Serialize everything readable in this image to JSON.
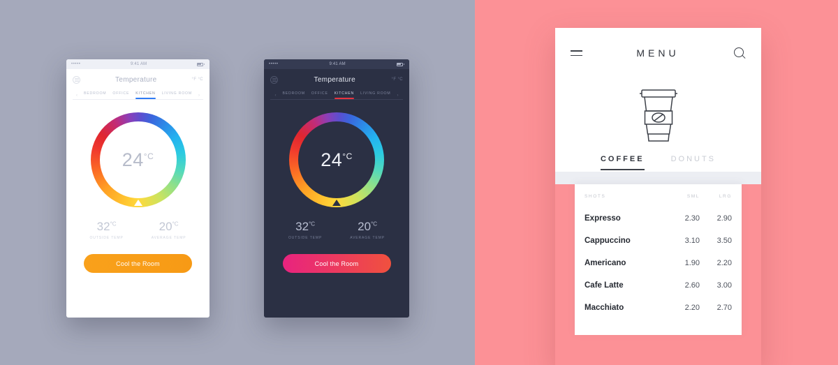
{
  "backgrounds": {
    "left": "#a5a9bb",
    "right": "#fc9196"
  },
  "thermostat": {
    "status_bar": {
      "signal": "•••••",
      "time": "9:41 AM"
    },
    "header": {
      "title": "Temperature",
      "menu_icon": "menu-circle-icon",
      "unit_toggle": "°F °C"
    },
    "room_tabs": {
      "prev_arrow": "‹",
      "next_arrow": "›",
      "items": [
        "BEDROOM",
        "OFFICE",
        "KITCHEN",
        "LIVING ROOM"
      ],
      "active_index": 2
    },
    "dial": {
      "value": "24",
      "unit": "°C",
      "marker_icon": "dial-marker-triangle"
    },
    "readings": [
      {
        "value": "32",
        "unit": "°C",
        "label": "OUTSIDE TEMP"
      },
      {
        "value": "20",
        "unit": "°C",
        "label": "AVERAGE TEMP"
      }
    ],
    "cta_label": "Cool the Room",
    "cta_color_light": "#f9a11b",
    "cta_color_dark": "#e8237f"
  },
  "menu": {
    "hamburger_icon": "hamburger-icon",
    "title": "MENU",
    "search_icon": "search-icon",
    "cup_icon": "coffee-cup-icon",
    "tabs": [
      {
        "label": "COFFEE",
        "active": true
      },
      {
        "label": "DONUTS",
        "active": false
      }
    ],
    "table": {
      "headers": {
        "name": "SHOTS",
        "sml": "SML",
        "lrg": "LRG"
      },
      "rows": [
        {
          "name": "Expresso",
          "sml": "2.30",
          "lrg": "2.90"
        },
        {
          "name": "Cappuccino",
          "sml": "3.10",
          "lrg": "3.50"
        },
        {
          "name": "Americano",
          "sml": "1.90",
          "lrg": "2.20"
        },
        {
          "name": "Cafe Latte",
          "sml": "2.60",
          "lrg": "3.00"
        },
        {
          "name": "Macchiato",
          "sml": "2.20",
          "lrg": "2.70"
        }
      ]
    }
  }
}
